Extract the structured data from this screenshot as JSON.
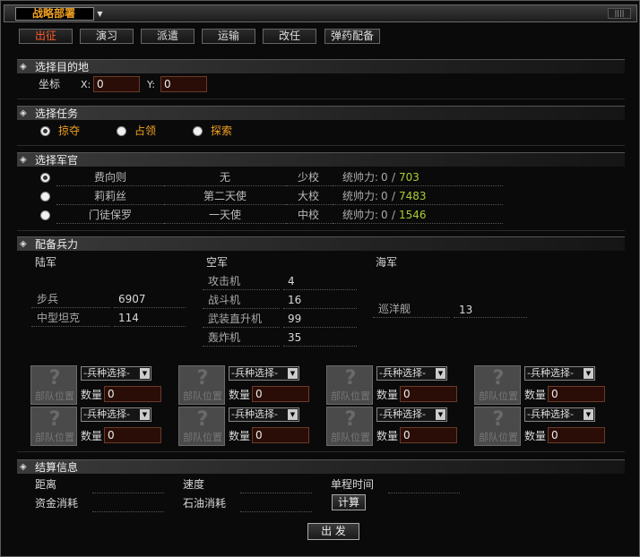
{
  "window": {
    "title": "战略部署"
  },
  "tabs": [
    {
      "label": "出征",
      "active": true
    },
    {
      "label": "演习"
    },
    {
      "label": "派遣"
    },
    {
      "label": "运输"
    },
    {
      "label": "改任"
    },
    {
      "label": "弹药配备"
    }
  ],
  "destination": {
    "section_title": "选择目的地",
    "coord_label": "坐标",
    "x_label": "X:",
    "x_value": "0",
    "y_label": "Y:",
    "y_value": "0"
  },
  "mission": {
    "section_title": "选择任务",
    "options": [
      {
        "label": "掠夺",
        "selected": true
      },
      {
        "label": "占领"
      },
      {
        "label": "探索"
      }
    ]
  },
  "officers": {
    "section_title": "选择军官",
    "rows": [
      {
        "name": "费向则",
        "title": "无",
        "rank": "少校",
        "cmd_label": "统帅力:",
        "cmd_current": "0",
        "cmd_sep": "/",
        "cmd_max": "703",
        "selected": true
      },
      {
        "name": "莉莉丝",
        "title": "第二天使",
        "rank": "大校",
        "cmd_label": "统帅力:",
        "cmd_current": "0",
        "cmd_sep": "/",
        "cmd_max": "7483"
      },
      {
        "name": "门徒保罗",
        "title": "一天使",
        "rank": "中校",
        "cmd_label": "统帅力:",
        "cmd_current": "0",
        "cmd_sep": "/",
        "cmd_max": "1546"
      }
    ]
  },
  "troops": {
    "section_title": "配备兵力",
    "army": {
      "label": "陆军",
      "units": [
        {
          "name": "步兵",
          "count": "6907"
        },
        {
          "name": "中型坦克",
          "count": "114"
        }
      ]
    },
    "air": {
      "label": "空军",
      "units": [
        {
          "name": "攻击机",
          "count": "4"
        },
        {
          "name": "战斗机",
          "count": "16"
        },
        {
          "name": "武装直升机",
          "count": "99"
        },
        {
          "name": "轰炸机",
          "count": "35"
        }
      ]
    },
    "navy": {
      "label": "海军",
      "units": [
        {
          "name": "巡洋舰",
          "count": "13"
        }
      ]
    }
  },
  "slots": {
    "box_label": "部队位置",
    "select_label": "-兵种选择-",
    "qty_label": "数量",
    "qty_value": "0",
    "icon_glyph": "?"
  },
  "settlement": {
    "section_title": "结算信息",
    "distance_label": "距离",
    "speed_label": "速度",
    "time_label": "单程时间",
    "fund_label": "资金消耗",
    "oil_label": "石油消耗",
    "calc_button": "计算"
  },
  "depart_button": "出 发",
  "icons": {
    "section": "tag-icon",
    "dropdown": "triangle-down-icon"
  },
  "colors": {
    "accent": "#f0a020",
    "active_tab": "#ff5a2a",
    "value_green": "#aacc33",
    "input_bg": "#2a0d06"
  }
}
